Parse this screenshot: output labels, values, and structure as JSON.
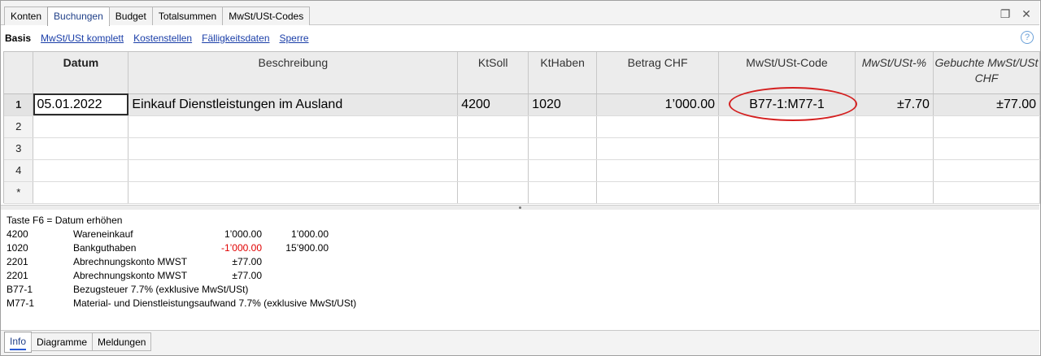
{
  "tabs": [
    "Konten",
    "Buchungen",
    "Budget",
    "Totalsummen",
    "MwSt/USt-Codes"
  ],
  "active_tab": "Buchungen",
  "views": {
    "basis": "Basis",
    "links": [
      "MwSt/USt komplett",
      "Kostenstellen",
      "Fälligkeitsdaten",
      "Sperre"
    ]
  },
  "help_glyph": "?",
  "restore_glyph": "❐",
  "close_glyph": "✕",
  "columns": {
    "datum": "Datum",
    "beschreibung": "Beschreibung",
    "ktsoll": "KtSoll",
    "kthaben": "KtHaben",
    "betrag": "Betrag CHF",
    "mwst_code": "MwSt/USt-Code",
    "mwst_pct": "MwSt/USt-%",
    "gebuchte_line1": "Gebuchte MwSt/USt",
    "gebuchte_line2": "CHF"
  },
  "rows": [
    {
      "num": "1",
      "datum": "05.01.2022",
      "beschreibung": "Einkauf Dienstleistungen im Ausland",
      "ktsoll": "4200",
      "kthaben": "1020",
      "betrag": "1’000.00",
      "mwst_code": "B77-1:M77-1",
      "mwst_pct": "±7.70",
      "gebuchte": "±77.00"
    },
    {
      "num": "2",
      "datum": "",
      "beschreibung": "",
      "ktsoll": "",
      "kthaben": "",
      "betrag": "",
      "mwst_code": "",
      "mwst_pct": "",
      "gebuchte": ""
    },
    {
      "num": "3",
      "datum": "",
      "beschreibung": "",
      "ktsoll": "",
      "kthaben": "",
      "betrag": "",
      "mwst_code": "",
      "mwst_pct": "",
      "gebuchte": ""
    },
    {
      "num": "4",
      "datum": "",
      "beschreibung": "",
      "ktsoll": "",
      "kthaben": "",
      "betrag": "",
      "mwst_code": "",
      "mwst_pct": "",
      "gebuchte": ""
    },
    {
      "num": "*",
      "datum": "",
      "beschreibung": "",
      "ktsoll": "",
      "kthaben": "",
      "betrag": "",
      "mwst_code": "",
      "mwst_pct": "",
      "gebuchte": ""
    }
  ],
  "info": {
    "hint": "Taste F6 = Datum erhöhen",
    "lines": [
      {
        "code": "4200",
        "text": "Wareneinkauf",
        "amount": "1’000.00",
        "balance": "1’000.00"
      },
      {
        "code": "1020",
        "text": "Bankguthaben",
        "amount": "-1’000.00",
        "balance": "15’900.00"
      },
      {
        "code": "2201",
        "text": "Abrechnungskonto MWST",
        "amount": "±77.00",
        "balance": ""
      },
      {
        "code": "2201",
        "text": "Abrechnungskonto MWST",
        "amount": "±77.00",
        "balance": ""
      },
      {
        "code": "B77-1",
        "text": "Bezugsteuer 7.7% (exklusive MwSt/USt)",
        "amount": "",
        "balance": ""
      },
      {
        "code": "M77-1",
        "text": "Material- und Dienstleistungsaufwand 7.7% (exklusive MwSt/USt)",
        "amount": "",
        "balance": ""
      }
    ]
  },
  "bottom_tabs": [
    "Info",
    "Diagramme",
    "Meldungen"
  ],
  "colors": {
    "accent": "#1f3f88",
    "link": "#1a3ea8",
    "negative": "#e00000",
    "highlight": "#d42020"
  }
}
